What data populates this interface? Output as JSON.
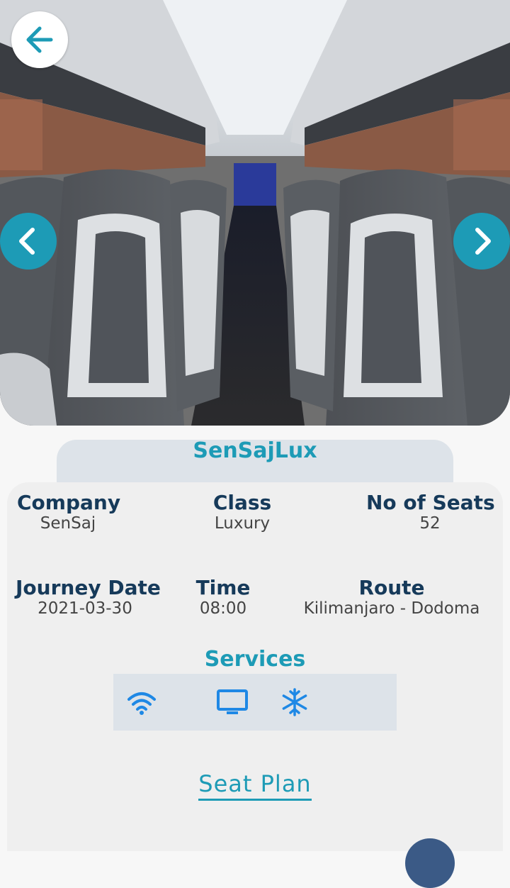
{
  "hero": {
    "image_alt": "Bus interior with leather seats"
  },
  "controls": {
    "back_icon": "arrow-left-icon",
    "prev_icon": "chevron-left-icon",
    "next_icon": "chevron-right-icon"
  },
  "bus": {
    "name": "SenSajLux"
  },
  "details": {
    "company_label": "Company",
    "company_value": "SenSaj",
    "class_label": "Class",
    "class_value": "Luxury",
    "seats_label": "No of Seats",
    "seats_value": "52",
    "date_label": "Journey Date",
    "date_value": "2021-03-30",
    "time_label": "Time",
    "time_value": "08:00",
    "route_label": "Route",
    "route_value": "Kilimanjaro - Dodoma"
  },
  "services": {
    "title": "Services",
    "items": [
      "wifi-icon",
      "tv-icon",
      "snowflake-icon"
    ]
  },
  "actions": {
    "seat_plan_label": "Seat Plan"
  },
  "colors": {
    "accent": "#1d9bb6",
    "heading": "#163a5a",
    "tab_bg": "#dde3e9",
    "card_bg": "#efefef"
  }
}
